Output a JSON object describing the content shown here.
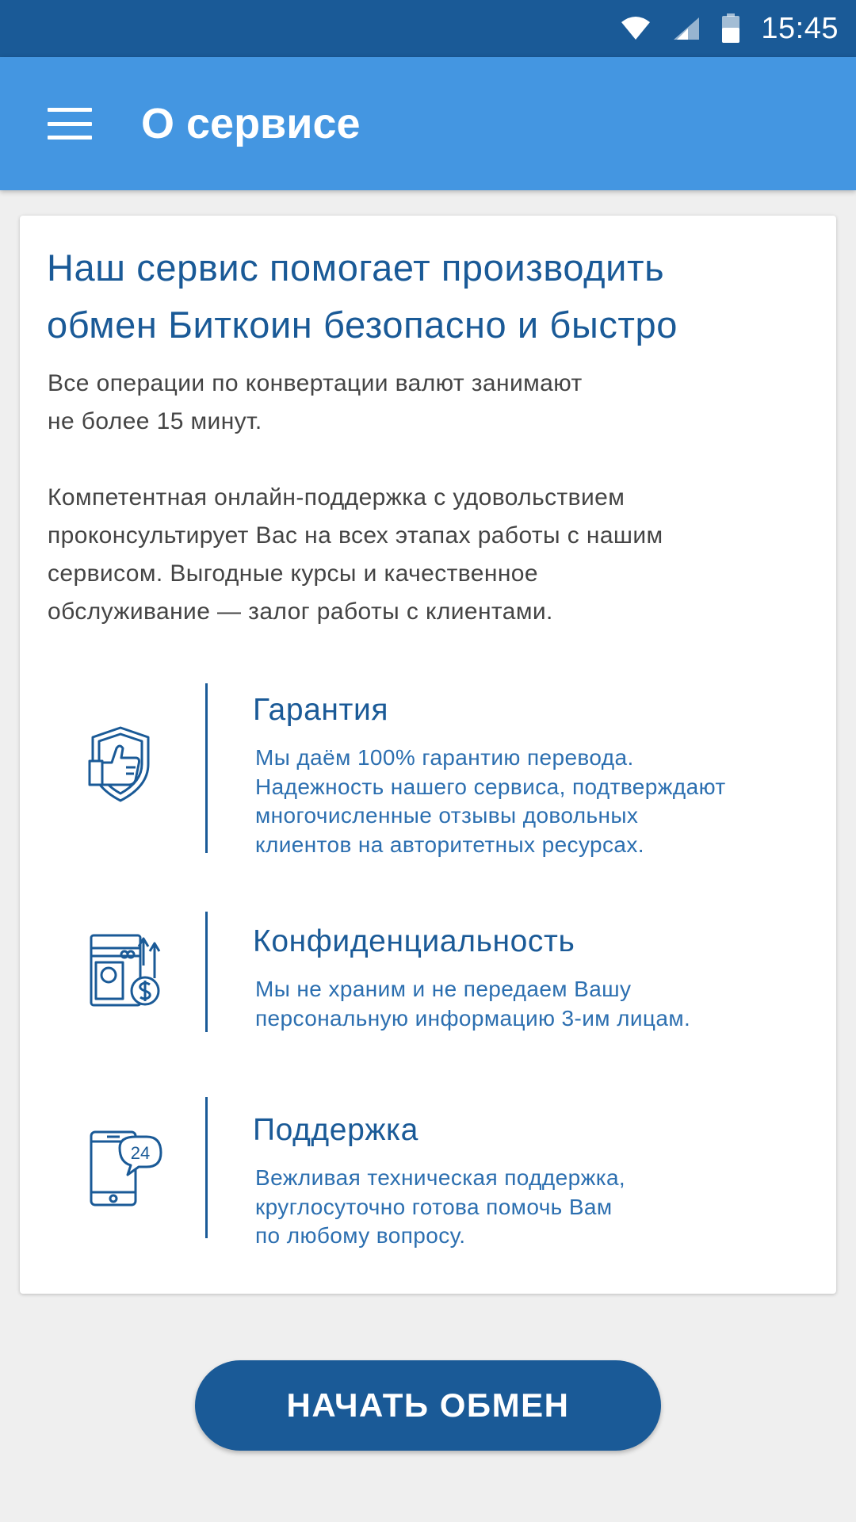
{
  "status_bar": {
    "time": "15:45",
    "icons": [
      "wifi-icon",
      "signal-icon",
      "battery-icon"
    ]
  },
  "app_bar": {
    "title": "О сервисе",
    "menu_icon": "hamburger-menu-icon"
  },
  "content": {
    "headline_line1": "Наш сервис помогает производить",
    "headline_line2": "обмен Биткоин безопасно и быстро",
    "intro_line1": "Все операции по конвертации валют занимают",
    "intro_line2": "не более 15 минут.",
    "support_line1": "Компетентная онлайн-поддержка с удовольствием",
    "support_line2": "проконсультирует Вас на всех этапах работы с нашим",
    "support_line3": "сервисом. Выгодные курсы и качественное",
    "support_line4": "обслуживание — залог работы с клиентами."
  },
  "features": [
    {
      "icon": "shield-thumbs-up-icon",
      "title": "Гарантия",
      "lines": [
        "Мы даём 100% гарантию перевода.",
        "Надежность нашего сервиса, подтверждают",
        "многочисленные отзывы довольных",
        "клиентов на авторитетных ресурсах."
      ]
    },
    {
      "icon": "wallet-money-transfer-icon",
      "title": "Конфиденциальность",
      "lines": [
        "Мы не храним и не передаем Вашу",
        "персональную информацию 3-им лицам."
      ]
    },
    {
      "icon": "phone-24-support-icon",
      "title": "Поддержка",
      "lines": [
        "Вежливая техническая поддержка,",
        "круглосуточно готова помочь Вам",
        "по любому вопросу."
      ]
    }
  ],
  "cta": {
    "label": "НАЧАТЬ ОБМЕН"
  },
  "colors": {
    "status_bar": "#1a5a97",
    "app_bar": "#4496e1",
    "accent": "#1a5a97",
    "background": "#efefef"
  }
}
